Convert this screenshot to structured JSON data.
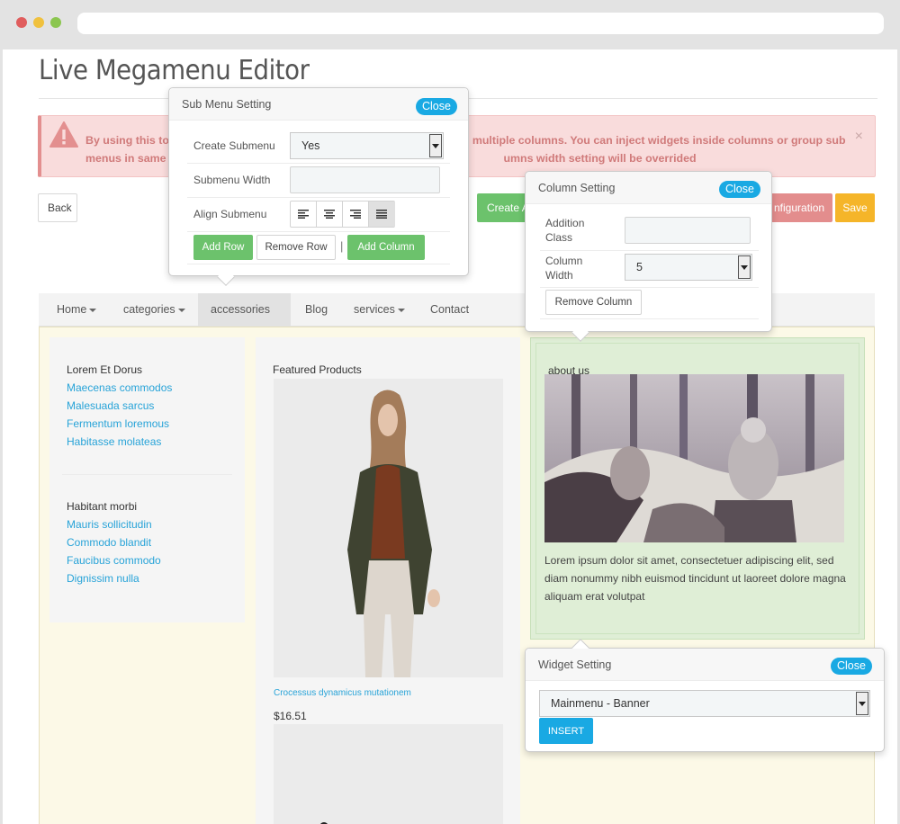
{
  "page": {
    "title": "Live Megamenu Editor"
  },
  "alert": {
    "text_part1": "By using this to",
    "text_part2": "multiple columns. You can inject widgets inside columns or group sub",
    "text_line2a": "menus in same",
    "text_line2b": "umns width setting will be overrided",
    "close": "×"
  },
  "toolbar": {
    "back": "Back",
    "create": "Create A",
    "config": "nfiguration",
    "save": "Save"
  },
  "menu": [
    {
      "label": "Home",
      "dropdown": true
    },
    {
      "label": "categories",
      "dropdown": true
    },
    {
      "label": "accessories",
      "dropdown": true,
      "active": true
    },
    {
      "label": "Blog",
      "dropdown": false
    },
    {
      "label": "services",
      "dropdown": true
    },
    {
      "label": "Contact",
      "dropdown": false
    }
  ],
  "col1": {
    "group1_title": "Lorem Et Dorus",
    "group1_links": [
      "Maecenas commodos",
      "Malesuada sarcus",
      "Fermentum loremous",
      "Habitasse molateas"
    ],
    "group2_title": "Habitant morbi",
    "group2_links": [
      "Mauris sollicitudin",
      "Commodo blandit",
      "Faucibus commodo",
      "Dignissim nulla"
    ]
  },
  "col2": {
    "title": "Featured Products",
    "product_name": "Crocessus dynamicus mutationem",
    "price": "$16.51"
  },
  "col3": {
    "title": "about us",
    "text": "Lorem ipsum dolor sit amet, consectetuer adipiscing elit, sed diam nonummy nibh euismod tincidunt ut laoreet dolore magna aliquam erat volutpat"
  },
  "submenu_setting": {
    "title": "Sub Menu Setting",
    "close": "Close",
    "create_label": "Create Submenu",
    "create_value": "Yes",
    "width_label": "Submenu Width",
    "width_value": "",
    "align_label": "Align Submenu",
    "align_options": [
      "align-left-icon",
      "align-center-icon",
      "align-right-icon",
      "align-justify-icon"
    ],
    "add_row": "Add Row",
    "remove_row": "Remove Row",
    "separator": "|",
    "add_column": "Add Column"
  },
  "column_setting": {
    "title": "Column Setting",
    "close": "Close",
    "class_label_1": "Addition",
    "class_label_2": "Class",
    "class_value": "",
    "width_label_1": "Column",
    "width_label_2": "Width",
    "width_value": "5",
    "remove_column": "Remove Column"
  },
  "widget_setting": {
    "title": "Widget Setting",
    "close": "Close",
    "selected": "Mainmenu - Banner",
    "insert": "INSERT"
  },
  "colors": {
    "accent_blue": "#19a9e3",
    "green": "#6cc26c",
    "alert_bg": "#f9dcdc",
    "save_orange": "#f5b529"
  }
}
